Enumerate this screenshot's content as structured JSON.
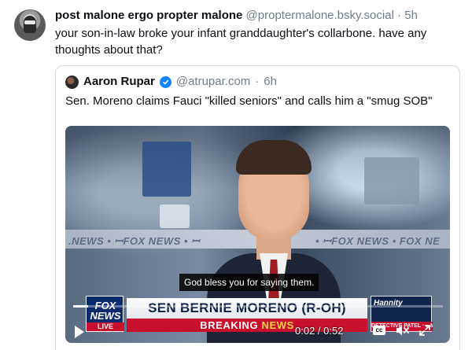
{
  "post": {
    "display_name": "post malone ergo propter malone",
    "handle": "@propter­malone.bsky.social",
    "separator": "·",
    "time": "5h",
    "text": "your son-in-law broke your infant granddaughter's collarbone.  have any thoughts about that?"
  },
  "quote": {
    "display_name": "Aaron Rupar",
    "handle": "@atrupar.com",
    "separator": "·",
    "time": "6h",
    "text": "Sen. Moreno claims Fauci \"killed seniors\" and calls him a \"smug SOB\""
  },
  "video": {
    "background_band_text": ".NEWS  •  ꟷFOX NEWS  •  ꟷ",
    "background_band_text_right": "•  ꟷFOX NEWS  •  FOX NE",
    "caption": "God bless you for saying them.",
    "chyron": {
      "logo_top": "FOX",
      "logo_bottom": "NEWS",
      "logo_live": "LIVE",
      "name": "SEN BERNIE MORENO (R-OH)",
      "breaking_a": "BREAKING ",
      "breaking_b": "NEWS",
      "promo_name": "Hannity",
      "promo_sub": "DETECTIVE PATEL · ...MING UP"
    },
    "time": "0:02 / 0:52",
    "progress_fraction": 0.04,
    "cc_label": "cc",
    "icons": {
      "play": "play-icon",
      "cc": "closed-captions-icon",
      "volume": "volume-muted-icon",
      "fullscreen": "fullscreen-icon",
      "verified": "verified-check-icon"
    }
  },
  "colors": {
    "text_primary": "#0b0f14",
    "text_secondary": "#6f7e8c",
    "border": "#d4dbe2",
    "verified_blue": "#1083fe",
    "fox_red": "#c8102e",
    "fox_navy": "#0a2a6e"
  }
}
